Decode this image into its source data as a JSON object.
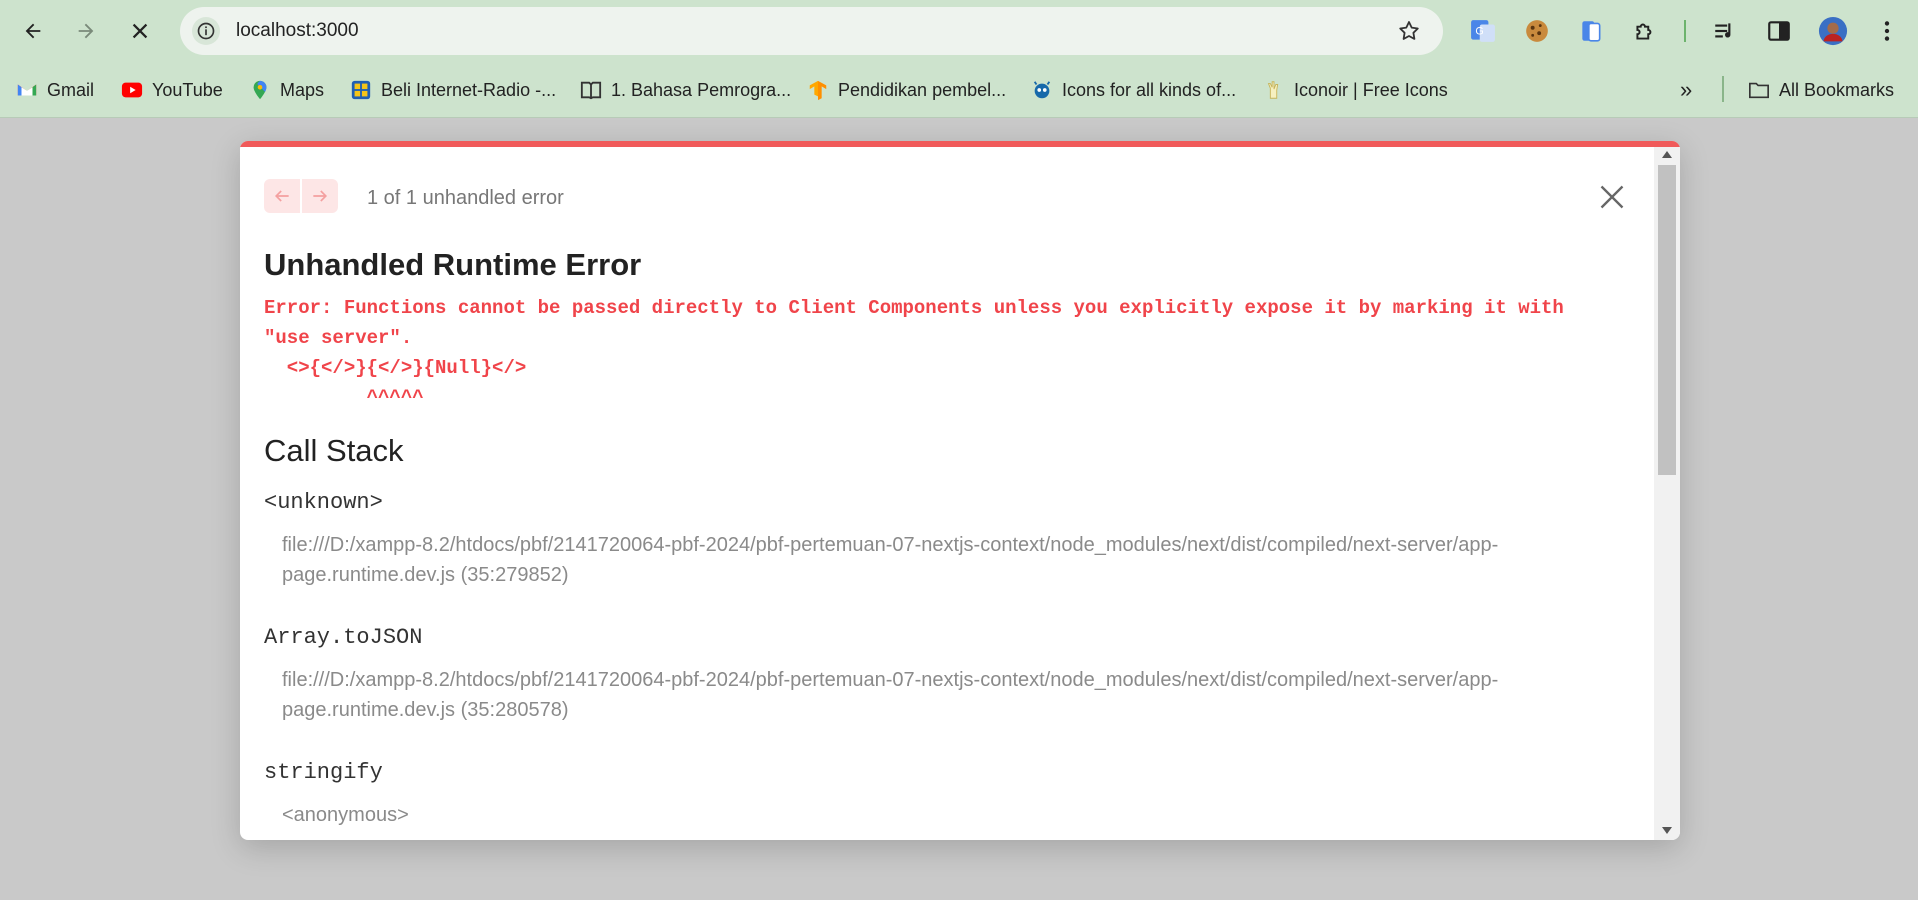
{
  "browser": {
    "url": "localhost:3000",
    "nav": {
      "back": "back-arrow-icon",
      "forward": "forward-arrow-icon",
      "stop": "close-icon"
    },
    "extensions": [
      "google-translate-icon",
      "cookie-icon",
      "phone-icon",
      "puzzle-icon",
      "media-queue-icon",
      "side-panel-icon",
      "profile-avatar",
      "more-menu-icon"
    ]
  },
  "bookmarks": {
    "items": [
      {
        "label": "Gmail",
        "icon": "gmail-icon"
      },
      {
        "label": "YouTube",
        "icon": "youtube-icon"
      },
      {
        "label": "Maps",
        "icon": "maps-icon"
      },
      {
        "label": "Beli Internet-Radio -...",
        "icon": "radio-icon"
      },
      {
        "label": "1. Bahasa Pemrogra...",
        "icon": "book-icon"
      },
      {
        "label": "Pendidikan pembel...",
        "icon": "tensorflow-icon"
      },
      {
        "label": "Icons for all kinds of...",
        "icon": "iconify-icon"
      },
      {
        "label": "Iconoir | Free Icons",
        "icon": "iconoir-icon"
      }
    ],
    "overflow": "»",
    "all_bookmarks": "All Bookmarks"
  },
  "overlay": {
    "counter": "1 of 1 unhandled error",
    "title": "Unhandled Runtime Error",
    "error_lines": [
      "Error: Functions cannot be passed directly to Client Components unless you explicitly expose it by marking it with",
      "\"use server\".",
      "  <>{</>}{</>}{Null}</>",
      "         ^^^^^"
    ],
    "call_stack_title": "Call Stack",
    "frames": [
      {
        "name": "<unknown>",
        "location_line1": "file:///D:/xampp-8.2/htdocs/pbf/2141720064-pbf-2024/pbf-pertemuan-07-nextjs-context/node_modules/next/dist/compiled/next-server/app-",
        "location_line2": "page.runtime.dev.js (35:279852)"
      },
      {
        "name": "Array.toJSON",
        "location_line1": "file:///D:/xampp-8.2/htdocs/pbf/2141720064-pbf-2024/pbf-pertemuan-07-nextjs-context/node_modules/next/dist/compiled/next-server/app-",
        "location_line2": "page.runtime.dev.js (35:280578)"
      },
      {
        "name": "stringify",
        "location_line1": "<anonymous>",
        "location_line2": ""
      }
    ]
  },
  "colors": {
    "chrome_bg": "#cde3cd",
    "page_bg": "#c9c9c9",
    "error_red": "#f0444a",
    "top_stripe": "#f05a5a"
  }
}
